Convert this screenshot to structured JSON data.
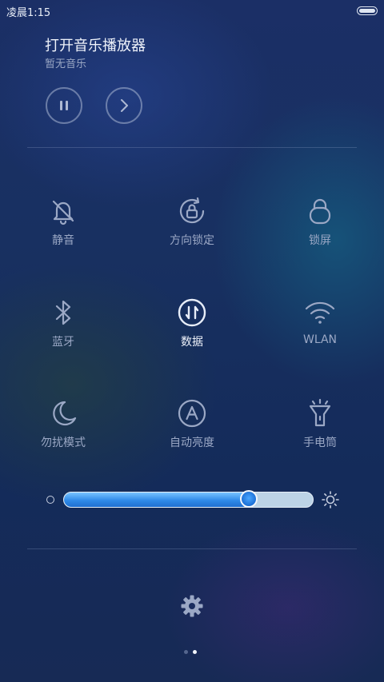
{
  "status_bar": {
    "time": "凌晨1:15"
  },
  "music": {
    "title": "打开音乐播放器",
    "subtitle": "暂无音乐"
  },
  "toggles": [
    {
      "label": "静音",
      "icon": "mute-bell-icon",
      "active": false
    },
    {
      "label": "方向锁定",
      "icon": "rotation-lock-icon",
      "active": false
    },
    {
      "label": "锁屏",
      "icon": "lock-icon",
      "active": false
    },
    {
      "label": "蓝牙",
      "icon": "bluetooth-icon",
      "active": false
    },
    {
      "label": "数据",
      "icon": "mobile-data-icon",
      "active": true
    },
    {
      "label": "WLAN",
      "icon": "wifi-icon",
      "active": false
    },
    {
      "label": "勿扰模式",
      "icon": "moon-icon",
      "active": false
    },
    {
      "label": "自动亮度",
      "icon": "auto-brightness-icon",
      "active": false
    },
    {
      "label": "手电筒",
      "icon": "flashlight-icon",
      "active": false
    }
  ],
  "brightness": {
    "level": 0.74
  },
  "pager": {
    "pages": 2,
    "current": 2
  },
  "colors": {
    "accent": "#2f8ae8",
    "inactive_label": "#9ba8c5",
    "active_label": "#eef2fa"
  }
}
